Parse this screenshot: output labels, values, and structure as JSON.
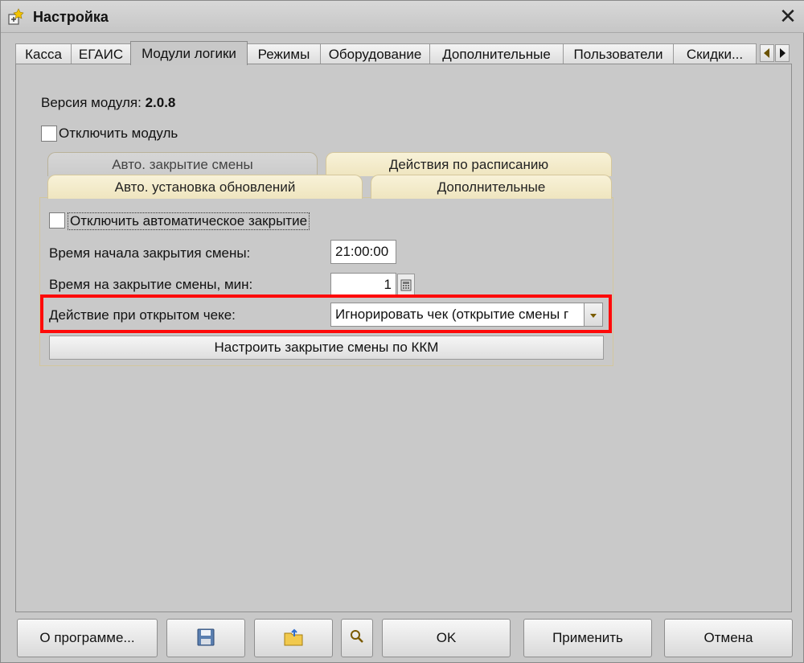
{
  "window": {
    "title": "Настройка"
  },
  "tabs": [
    "Касса",
    "ЕГАИС",
    "Модули логики",
    "Режимы",
    "Оборудование",
    "Дополнительные",
    "Пользователи",
    "Скидки..."
  ],
  "module": {
    "version_label": "Версия модуля:",
    "version_value": "2.0.8",
    "disable_label": "Отключить модуль"
  },
  "subtabs": {
    "row1": [
      "Авто. закрытие смены",
      "Действия по расписанию"
    ],
    "row2": [
      "Авто. установка обновлений",
      "Дополнительные"
    ]
  },
  "form": {
    "disable_auto_close_label": "Отключить автоматическое закрытие",
    "start_time_label": "Время начала закрытия смены:",
    "start_time_value": "21:00:00",
    "close_minutes_label": "Время на закрытие смены, мин:",
    "close_minutes_value": "1",
    "open_check_action_label": "Действие при открытом чеке:",
    "open_check_action_value": "Игнорировать чек (открытие смены г",
    "configure_button": "Настроить закрытие смены по ККМ"
  },
  "footer": {
    "about": "О программе...",
    "ok": "OK",
    "apply": "Применить",
    "cancel": "Отмена"
  },
  "colors": {
    "highlight": "#ff0a0a",
    "subtab_bg": "#f1e8c4"
  }
}
